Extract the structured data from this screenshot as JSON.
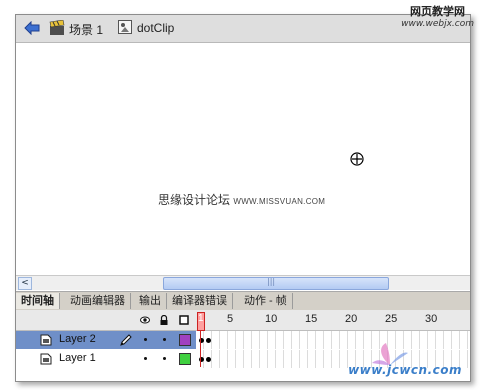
{
  "watermark_top": {
    "line1": "网页教学网",
    "line2": "www.webjx.com"
  },
  "titlebar": {
    "scene_label": "场景 1",
    "symbol_label": "dotClip"
  },
  "stage": {
    "text_main": "思缘设计论坛",
    "text_url": "WWW.MISSVUAN.COM"
  },
  "scrollbar": {
    "left_arrow": "<",
    "grip": "|||"
  },
  "tabs": [
    {
      "label": "时间轴"
    },
    {
      "label": "动画编辑器"
    },
    {
      "label": "输出"
    },
    {
      "label": "编译器错误"
    },
    {
      "label": "动作 - 帧"
    }
  ],
  "timeline": {
    "ruler": [
      "1",
      "5",
      "10",
      "15",
      "20",
      "25",
      "30"
    ],
    "layers": [
      {
        "name": "Layer 2",
        "color": "#a040c0",
        "selected": true
      },
      {
        "name": "Layer 1",
        "color": "#40d040",
        "selected": false
      }
    ]
  },
  "watermark_bottom": "www.jcwcn.com",
  "colors": {
    "selection": "#6f8fc8",
    "playhead": "#cc2222",
    "accent": "#8aa7dc"
  }
}
